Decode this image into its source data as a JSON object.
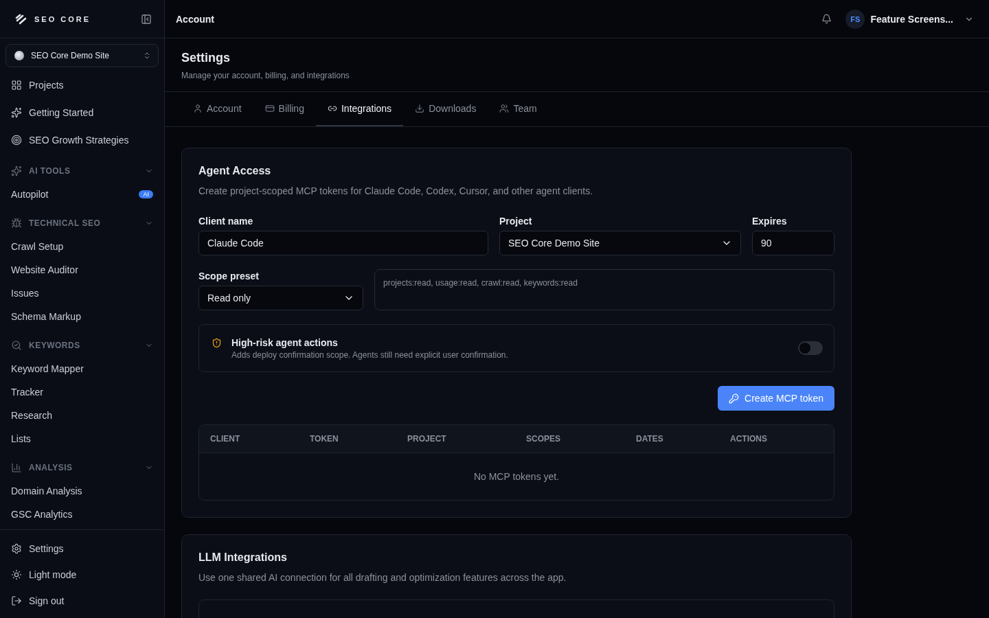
{
  "sidebar": {
    "brand": "SEO CORE",
    "site_selector": "SEO Core Demo Site",
    "top_items": [
      {
        "label": "Projects"
      },
      {
        "label": "Getting Started"
      },
      {
        "label": "SEO Growth Strategies"
      }
    ],
    "sections": [
      {
        "title": "AI TOOLS",
        "expanded": true,
        "items": [
          {
            "label": "Autopilot",
            "badge": "AI"
          }
        ]
      },
      {
        "title": "TECHNICAL SEO",
        "expanded": true,
        "items": [
          {
            "label": "Crawl Setup"
          },
          {
            "label": "Website Auditor"
          },
          {
            "label": "Issues"
          },
          {
            "label": "Schema Markup"
          }
        ]
      },
      {
        "title": "KEYWORDS",
        "expanded": true,
        "items": [
          {
            "label": "Keyword Mapper"
          },
          {
            "label": "Tracker"
          },
          {
            "label": "Research"
          },
          {
            "label": "Lists"
          }
        ]
      },
      {
        "title": "ANALYSIS",
        "expanded": true,
        "items": [
          {
            "label": "Domain Analysis"
          },
          {
            "label": "GSC Analytics"
          }
        ]
      }
    ],
    "bottom_items": [
      {
        "label": "Settings"
      },
      {
        "label": "Light mode"
      },
      {
        "label": "Sign out"
      }
    ]
  },
  "header": {
    "title": "Account",
    "user_initials": "FS",
    "user_name": "Feature Screens..."
  },
  "page": {
    "title": "Settings",
    "subtitle": "Manage your account, billing, and integrations"
  },
  "tabs": [
    {
      "label": "Account",
      "selected": false
    },
    {
      "label": "Billing",
      "selected": false
    },
    {
      "label": "Integrations",
      "selected": true
    },
    {
      "label": "Downloads",
      "selected": false
    },
    {
      "label": "Team",
      "selected": false
    }
  ],
  "agent_access": {
    "title": "Agent Access",
    "description": "Create project-scoped MCP tokens for Claude Code, Codex, Cursor, and other agent clients.",
    "client_name": {
      "label": "Client name",
      "value": "Claude Code"
    },
    "project": {
      "label": "Project",
      "value": "SEO Core Demo Site"
    },
    "expires": {
      "label": "Expires",
      "value": "90"
    },
    "scope_preset": {
      "label": "Scope preset",
      "value": "Read only"
    },
    "scopes": "projects:read, usage:read, crawl:read, keywords:read",
    "high_risk": {
      "title": "High-risk agent actions",
      "description": "Adds deploy confirmation scope. Agents still need explicit user confirmation.",
      "on": false
    },
    "create_button": "Create MCP token",
    "table": {
      "columns": [
        "CLIENT",
        "TOKEN",
        "PROJECT",
        "SCOPES",
        "DATES",
        "ACTIONS"
      ],
      "empty": "No MCP tokens yet."
    }
  },
  "llm_integrations": {
    "title": "LLM Integrations",
    "description": "Use one shared AI connection for all drafting and optimization features across the app."
  }
}
